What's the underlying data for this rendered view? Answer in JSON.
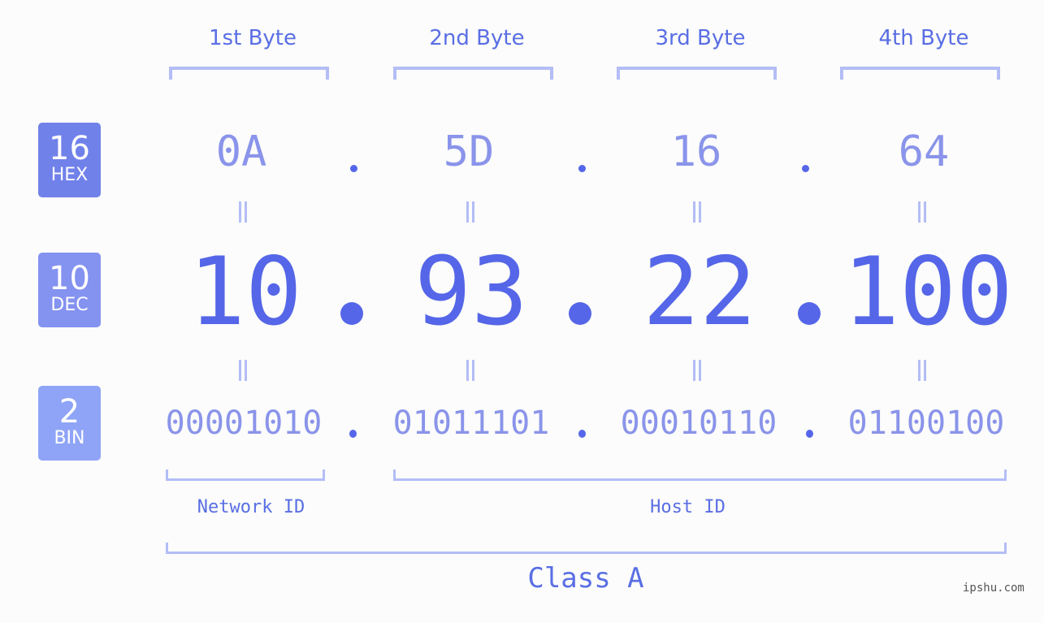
{
  "byte_headers": [
    "1st Byte",
    "2nd Byte",
    "3rd Byte",
    "4th Byte"
  ],
  "bases": {
    "hex": {
      "number": "16",
      "label": "HEX",
      "color": "#7181ea"
    },
    "dec": {
      "number": "10",
      "label": "DEC",
      "color": "#8492f0"
    },
    "bin": {
      "number": "2",
      "label": "BIN",
      "color": "#8fa4f6"
    }
  },
  "hex_values": [
    "0A",
    "5D",
    "16",
    "64"
  ],
  "dec_values": [
    "10",
    "93",
    "22",
    "100"
  ],
  "bin_values": [
    "00001010",
    "01011101",
    "00010110",
    "01100100"
  ],
  "separator": ".",
  "segments": {
    "network": "Network ID",
    "host": "Host ID"
  },
  "ip_class": "Class A",
  "watermark": "ipshu.com",
  "colors": {
    "primary": "#5566e8",
    "light": "#8a94ea",
    "bracket": "#b3bdf6"
  }
}
